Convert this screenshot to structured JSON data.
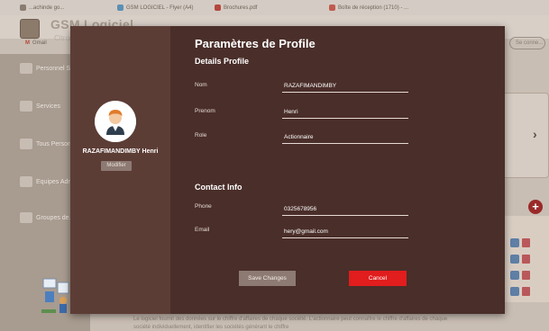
{
  "browser": {
    "tabs": [
      {
        "label": "...achinde go...",
        "icon": "tab-page-icon"
      },
      {
        "label": "GSM LOGICIEL - Flyer (A4)",
        "icon": "tab-canva-icon"
      },
      {
        "label": "Brochures.pdf",
        "icon": "tab-pdf-icon"
      },
      {
        "label": "Boîte de réception (1710) - ...",
        "icon": "tab-gmail-icon"
      }
    ],
    "bookmark": "Gmail"
  },
  "app": {
    "name": "GSM Logiciel",
    "subtitle": "Citron",
    "top_right_button": "Se conne..."
  },
  "nav": {
    "items": [
      {
        "label": "Personnel Sociétés",
        "icon": "building-icon"
      },
      {
        "label": "Services",
        "icon": "handshake-icon"
      },
      {
        "label": "Tous Person...",
        "icon": "users-icon"
      },
      {
        "label": "Equipes Adm...",
        "icon": "team-icon"
      },
      {
        "label": "Groupes de...",
        "icon": "group-icon"
      }
    ]
  },
  "footer": {
    "text": "Le logiciel fournit des données sur le chiffre d'affaires de chaque société. L'actionnaire peut connaître le chiffre d'affaires de chaque société individuellement, identifier les sociétés générant le chiffre"
  },
  "modal": {
    "title": "Paramètres de Profile",
    "profile": {
      "full_name": "RAZAFIMANDIMBY Henri",
      "modify_label": "Modifier"
    },
    "details_section": "Details Profile",
    "fields": {
      "nom_label": "Nom",
      "nom_value": "RAZAFIMANDIMBY",
      "prenom_label": "Prenom",
      "prenom_value": "Henri",
      "role_label": "Role",
      "role_value": "Actionnaire"
    },
    "contact_section": "Contact Info",
    "contact": {
      "phone_label": "Phone",
      "phone_value": "0325678956",
      "email_label": "Email",
      "email_value": "hery@gmail.com"
    },
    "save_label": "Save Changes",
    "cancel_label": "Cancel"
  },
  "colors": {
    "modal_bg": "#4a2e29",
    "modal_left": "#5c3d36",
    "cancel": "#e11d1d",
    "save": "#8d7a72"
  }
}
